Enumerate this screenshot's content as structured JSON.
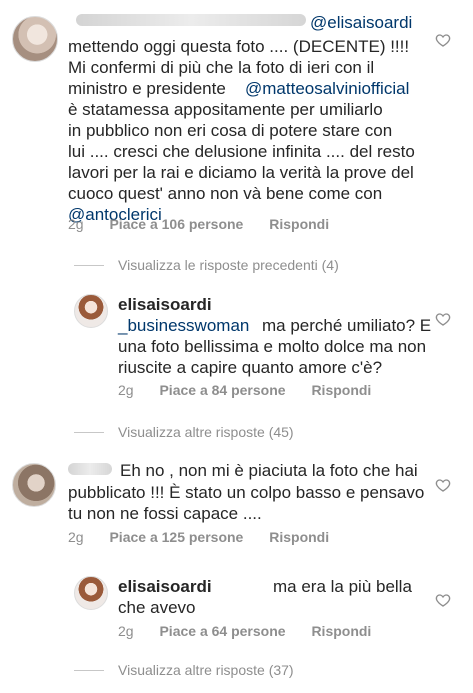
{
  "comments": [
    {
      "mention_username": "@elisaisoardi",
      "lines": [
        "mettendo oggi questa foto .... (DECENTE) !!!!",
        "Mi confermi di più  che la foto di ieri con il",
        "ministro e presidente",
        "è statamessa appositamente per umiliarlo",
        "in pubblico non eri cosa di potere stare con",
        "lui .... cresci che delusione infinita .... del resto",
        "lavori per la rai e diciamo la verità la prove del",
        "cuoco quest' anno non và bene come con"
      ],
      "inline_mention": "@matteosalviniofficial",
      "last_mention": "@antoclerici",
      "time": "2g",
      "likes": "Piace a 106 persone",
      "reply": "Rispondi"
    },
    {
      "username": "elisaisoardi",
      "lines": [
        "_businesswoman",
        "ma perché umiliato? E",
        "una foto bellissima e molto dolce ma non",
        "riuscite a capire quanto amore c'è?"
      ],
      "time": "2g",
      "likes": "Piace a 84 persone",
      "reply": "Rispondi"
    },
    {
      "lines": [
        "Eh no , non mi è piaciuta la foto che hai",
        "pubblicato !!! È stato un colpo basso e pensavo",
        "tu non ne fossi capace ...."
      ],
      "time": "2g",
      "likes": "Piace a 125 persone",
      "reply": "Rispondi"
    },
    {
      "username": "elisaisoardi",
      "lines": [
        "ma era la più bella",
        "che avevo"
      ],
      "time": "2g",
      "likes": "Piace a 64 persone",
      "reply": "Rispondi"
    }
  ],
  "thread_links": [
    "Visualizza le risposte precedenti (4)",
    "Visualizza altre risposte (45)",
    "Visualizza altre risposte (37)"
  ],
  "icons": {
    "like": "heart-outline-icon"
  },
  "colors": {
    "text": "#262626",
    "mention": "#00376b",
    "secondary": "#8e8e8e"
  }
}
